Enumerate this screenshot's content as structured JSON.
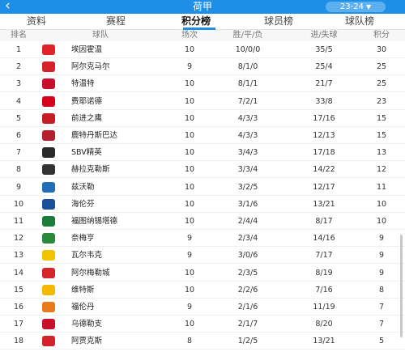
{
  "topbar": {
    "title": "荷甲",
    "season": "23-24",
    "back_icon": "back-chevron-icon",
    "caret_icon": "triangle-down-icon"
  },
  "tabs": [
    "资料",
    "赛程",
    "积分榜",
    "球员榜",
    "球队榜"
  ],
  "active_tab": 2,
  "columns": [
    "排名",
    "球队",
    "场次",
    "胜/平/负",
    "进/失球",
    "积分"
  ],
  "rows": [
    {
      "rank": "1",
      "team": "埃因霍温",
      "played": "10",
      "wdl": "10/0/0",
      "goals": "35/5",
      "points": "30",
      "logo_color": "#e0222b"
    },
    {
      "rank": "2",
      "team": "阿尔克马尔",
      "played": "9",
      "wdl": "8/1/0",
      "goals": "25/4",
      "points": "25",
      "logo_color": "#d4212a"
    },
    {
      "rank": "3",
      "team": "特温特",
      "played": "10",
      "wdl": "8/1/1",
      "goals": "21/7",
      "points": "25",
      "logo_color": "#c8102e"
    },
    {
      "rank": "4",
      "team": "费耶诺德",
      "played": "10",
      "wdl": "7/2/1",
      "goals": "33/8",
      "points": "23",
      "logo_color": "#d6001c"
    },
    {
      "rank": "5",
      "team": "前进之鹰",
      "played": "10",
      "wdl": "4/3/3",
      "goals": "17/16",
      "points": "15",
      "logo_color": "#c41e24"
    },
    {
      "rank": "6",
      "team": "鹿特丹斯巴达",
      "played": "10",
      "wdl": "4/3/3",
      "goals": "12/13",
      "points": "15",
      "logo_color": "#b51f2e"
    },
    {
      "rank": "7",
      "team": "SBV精英",
      "played": "10",
      "wdl": "3/4/3",
      "goals": "17/18",
      "points": "13",
      "logo_color": "#2a2a2a"
    },
    {
      "rank": "8",
      "team": "赫拉克勒斯",
      "played": "10",
      "wdl": "3/3/4",
      "goals": "14/22",
      "points": "12",
      "logo_color": "#333333"
    },
    {
      "rank": "9",
      "team": "兹沃勒",
      "played": "10",
      "wdl": "3/2/5",
      "goals": "12/17",
      "points": "11",
      "logo_color": "#1e6fb8"
    },
    {
      "rank": "10",
      "team": "海伦芬",
      "played": "10",
      "wdl": "3/1/6",
      "goals": "13/21",
      "points": "10",
      "logo_color": "#1a4f9c"
    },
    {
      "rank": "11",
      "team": "福图纳锡塔德",
      "played": "10",
      "wdl": "2/4/4",
      "goals": "8/17",
      "points": "10",
      "logo_color": "#1b7d3a"
    },
    {
      "rank": "12",
      "team": "奈梅亨",
      "played": "9",
      "wdl": "2/3/4",
      "goals": "14/16",
      "points": "9",
      "logo_color": "#2a8a3c"
    },
    {
      "rank": "13",
      "team": "瓦尔韦克",
      "played": "9",
      "wdl": "3/0/6",
      "goals": "7/17",
      "points": "9",
      "logo_color": "#f2c400"
    },
    {
      "rank": "14",
      "team": "阿尔梅勒城",
      "played": "10",
      "wdl": "2/3/5",
      "goals": "8/19",
      "points": "9",
      "logo_color": "#d6242b"
    },
    {
      "rank": "15",
      "team": "维特斯",
      "played": "10",
      "wdl": "2/2/6",
      "goals": "7/16",
      "points": "8",
      "logo_color": "#f5b800"
    },
    {
      "rank": "16",
      "team": "福伦丹",
      "played": "9",
      "wdl": "2/1/6",
      "goals": "11/19",
      "points": "7",
      "logo_color": "#e87a1a"
    },
    {
      "rank": "17",
      "team": "乌德勒支",
      "played": "10",
      "wdl": "2/1/7",
      "goals": "8/20",
      "points": "7",
      "logo_color": "#c8102e"
    },
    {
      "rank": "18",
      "team": "阿贾克斯",
      "played": "8",
      "wdl": "1/2/5",
      "goals": "13/21",
      "points": "5",
      "logo_color": "#d2232a"
    }
  ]
}
